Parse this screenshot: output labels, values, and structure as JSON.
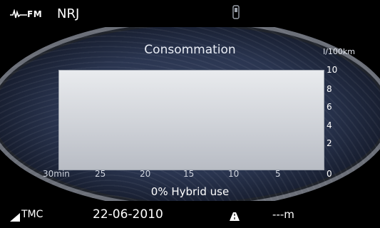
{
  "top_bar": {
    "band": "FM",
    "station": "NRJ",
    "radio_icon": "radio-wave-icon",
    "phone_icon": "phone-icon"
  },
  "screen": {
    "title": "Consommation",
    "unit": "l/100km",
    "y_ticks": [
      "10",
      "8",
      "6",
      "4",
      "2",
      "0"
    ],
    "x_ticks": [
      "30min",
      "25",
      "20",
      "15",
      "10",
      "5",
      "0"
    ],
    "hybrid_text": "0% Hybrid use"
  },
  "status_bar": {
    "tmc_icon": "signal-triangle-icon",
    "tmc": "TMC",
    "date": "22-06-2010",
    "nav_icon": "road-icon",
    "distance": "---m"
  },
  "colors": {
    "background": "#000000",
    "dial": "#2a3550",
    "plot": "#d6d9de",
    "text": "#ffffff"
  }
}
